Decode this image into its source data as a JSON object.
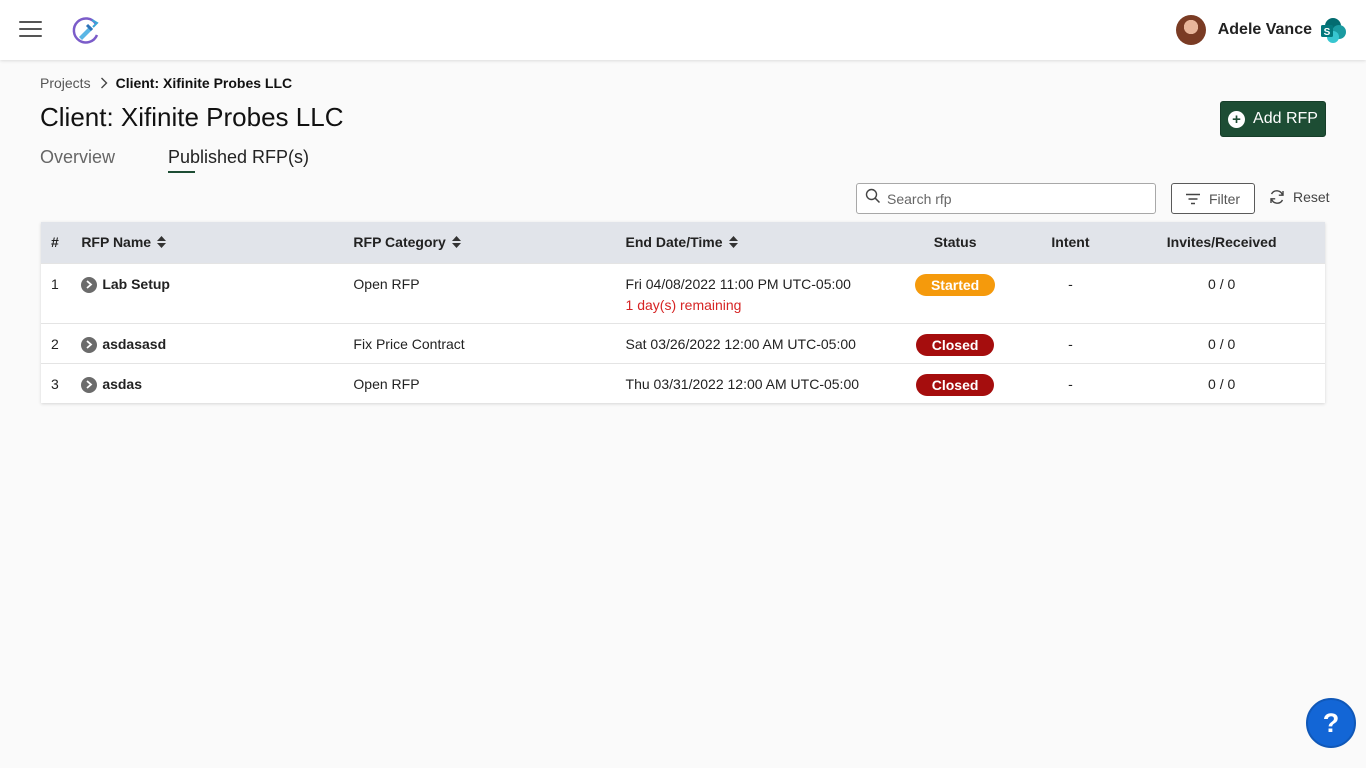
{
  "header": {
    "user_name": "Adele Vance"
  },
  "breadcrumb": {
    "parent": "Projects",
    "current": "Client: Xifinite Probes LLC"
  },
  "page": {
    "title": "Client: Xifinite Probes LLC",
    "add_button_label": "Add RFP"
  },
  "tabs": [
    {
      "label": "Overview",
      "active": false
    },
    {
      "label": "Published RFP(s)",
      "active": true
    }
  ],
  "toolbar": {
    "search_placeholder": "Search rfp",
    "filter_label": "Filter",
    "reset_label": "Reset"
  },
  "table": {
    "headers": {
      "num": "#",
      "name": "RFP Name",
      "category": "RFP Category",
      "end_date": "End Date/Time",
      "status": "Status",
      "intent": "Intent",
      "invites": "Invites/Received"
    },
    "rows": [
      {
        "num": "1",
        "name": "Lab Setup",
        "category": "Open RFP",
        "end_date": "Fri 04/08/2022 11:00 PM UTC-05:00",
        "remaining": "1 day(s) remaining",
        "status": "Started",
        "intent": "-",
        "invites": "0 / 0"
      },
      {
        "num": "2",
        "name": "asdasasd",
        "category": "Fix Price Contract",
        "end_date": "Sat 03/26/2022 12:00 AM UTC-05:00",
        "remaining": "",
        "status": "Closed",
        "intent": "-",
        "invites": "0 / 0"
      },
      {
        "num": "3",
        "name": "asdas",
        "category": "Open RFP",
        "end_date": "Thu 03/31/2022 12:00 AM UTC-05:00",
        "remaining": "",
        "status": "Closed",
        "intent": "-",
        "invites": "0 / 0"
      }
    ]
  },
  "help_button_label": "?",
  "colors": {
    "accent": "#1d4d34",
    "started": "#f59a0c",
    "closed": "#a50d0d",
    "remaining_text": "#d62424",
    "help": "#1366d6"
  },
  "icons": [
    "menu-icon",
    "app-logo-icon",
    "sharepoint-icon",
    "chevron-right-icon",
    "plus-circle-icon",
    "search-icon",
    "filter-icon",
    "refresh-icon",
    "sort-icon",
    "chevron-circle-right-icon"
  ]
}
